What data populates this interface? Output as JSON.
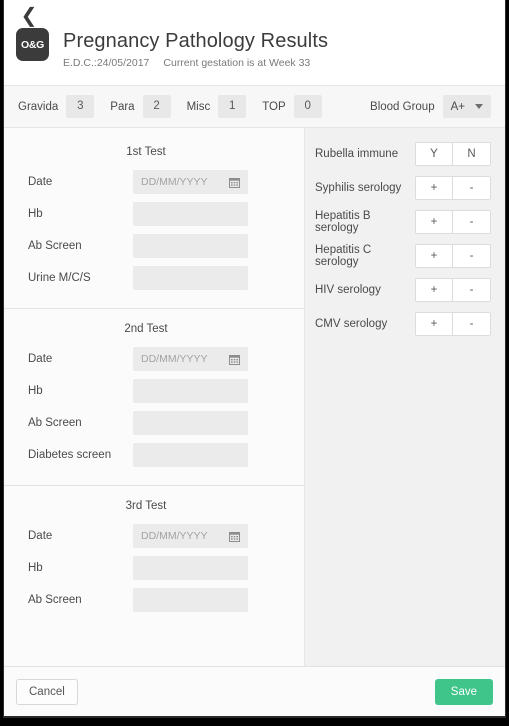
{
  "header": {
    "back_icon": "back-chevron-icon",
    "logo_text": "O&G",
    "title": "Pregnancy Pathology Results",
    "edc": "E.D.C.:24/05/2017",
    "gestation": "Current gestation is at Week 33"
  },
  "stats": {
    "items": [
      {
        "label": "Gravida",
        "value": "3"
      },
      {
        "label": "Para",
        "value": "2"
      },
      {
        "label": "Misc",
        "value": "1"
      },
      {
        "label": "TOP",
        "value": "0"
      }
    ],
    "blood_group_label": "Blood Group",
    "blood_group_value": "A+"
  },
  "tests": [
    {
      "title": "1st Test",
      "fields": [
        {
          "label": "Date",
          "placeholder": "DD/MM/YYYY",
          "value": "",
          "type": "date"
        },
        {
          "label": "Hb",
          "placeholder": "",
          "value": "",
          "type": "text"
        },
        {
          "label": "Ab Screen",
          "placeholder": "",
          "value": "",
          "type": "text"
        },
        {
          "label": "Urine M/C/S",
          "placeholder": "",
          "value": "",
          "type": "text"
        }
      ]
    },
    {
      "title": "2nd Test",
      "fields": [
        {
          "label": "Date",
          "placeholder": "DD/MM/YYYY",
          "value": "",
          "type": "date"
        },
        {
          "label": "Hb",
          "placeholder": "",
          "value": "",
          "type": "text"
        },
        {
          "label": "Ab Screen",
          "placeholder": "",
          "value": "",
          "type": "text"
        },
        {
          "label": "Diabetes screen",
          "placeholder": "",
          "value": "",
          "type": "text"
        }
      ]
    },
    {
      "title": "3rd Test",
      "fields": [
        {
          "label": "Date",
          "placeholder": "DD/MM/YYYY",
          "value": "",
          "type": "date"
        },
        {
          "label": "Hb",
          "placeholder": "",
          "value": "",
          "type": "text"
        },
        {
          "label": "Ab Screen",
          "placeholder": "",
          "value": "",
          "type": "text"
        }
      ]
    }
  ],
  "serology": [
    {
      "label": "Rubella immune",
      "pos": "Y",
      "neg": "N"
    },
    {
      "label": "Syphilis serology",
      "pos": "+",
      "neg": "-"
    },
    {
      "label": "Hepatitis B serology",
      "pos": "+",
      "neg": "-"
    },
    {
      "label": "Hepatitis C serology",
      "pos": "+",
      "neg": "-"
    },
    {
      "label": "HIV serology",
      "pos": "+",
      "neg": "-"
    },
    {
      "label": "CMV serology",
      "pos": "+",
      "neg": "-"
    }
  ],
  "footer": {
    "cancel_label": "Cancel",
    "save_label": "Save"
  },
  "colors": {
    "save_green": "#3fc48a",
    "logo_dark": "#3b3b3b",
    "input_gray": "#ebebeb",
    "right_panel": "#f1f1f1"
  }
}
